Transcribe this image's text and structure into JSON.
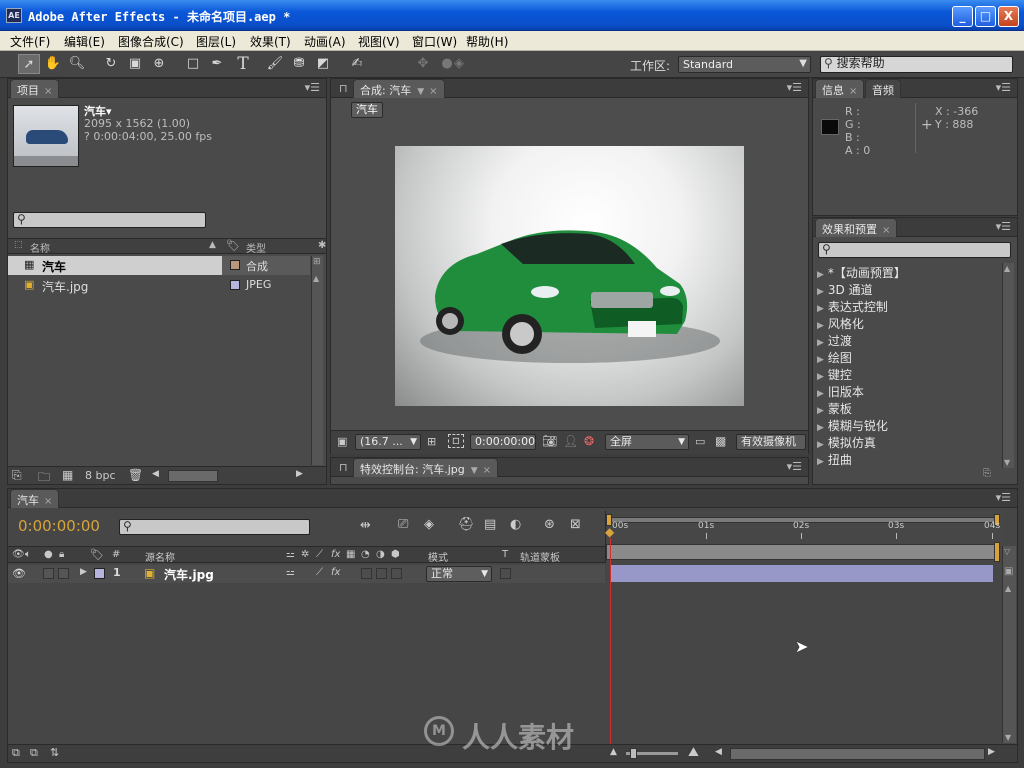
{
  "window": {
    "app_icon": "AE",
    "title": "Adobe After Effects - 未命名项目.aep *",
    "min": "_",
    "max": "□",
    "close": "X"
  },
  "menu": [
    "文件(F)",
    "编辑(E)",
    "图像合成(C)",
    "图层(L)",
    "效果(T)",
    "动画(A)",
    "视图(V)",
    "窗口(W)",
    "帮助(H)"
  ],
  "toolbar": {
    "workspace_label": "工作区:",
    "workspace_value": "Standard",
    "search_help": "搜索帮助"
  },
  "project": {
    "tab": "项目",
    "item_name": "汽车▾",
    "item_size": "2095 x 1562 (1.00)",
    "item_duration": "? 0:00:04:00, 25.00 fps",
    "col_name": "名称",
    "col_type": "类型",
    "rows": [
      {
        "name": "汽车",
        "type": "合成",
        "color": "#b8977a"
      },
      {
        "name": "汽车.jpg",
        "type": "JPEG",
        "color": "#b4b4dc"
      }
    ],
    "bpc": "8 bpc"
  },
  "composition": {
    "tab": "合成: 汽车",
    "flow_tag": "汽车",
    "zoom": "(16.7 ...",
    "timecode": "0:00:00:00",
    "resolution": "全屏",
    "camera": "有效摄像机"
  },
  "effect_controls": {
    "tab": "特效控制台: 汽车.jpg"
  },
  "info": {
    "tab": "信息",
    "tab2": "音频",
    "r": "R :",
    "g": "G :",
    "b": "B :",
    "a": "A : 0",
    "x": "X : -366",
    "y": "Y : 888"
  },
  "effects": {
    "tab": "效果和预置",
    "items": [
      "*【动画预置】",
      "3D 通道",
      "表达式控制",
      "风格化",
      "过渡",
      "绘图",
      "键控",
      "旧版本",
      "蒙板",
      "模糊与锐化",
      "模拟仿真",
      "扭曲"
    ]
  },
  "timeline": {
    "tab": "汽车",
    "timecode": "0:00:00:00",
    "col_hash": "#",
    "col_source": "源名称",
    "col_mode": "模式",
    "col_t": "T",
    "col_trkmat": "轨道蒙板",
    "layer_num": "1",
    "layer_name": "汽车.jpg",
    "layer_mode": "正常",
    "ticks": [
      "00s",
      "01s",
      "02s",
      "03s",
      "04s"
    ]
  },
  "watermark": "人人素材",
  "colors": {
    "layer_bar": "#9898c8",
    "timecode": "#d7a43c",
    "playhead": "#d03030"
  }
}
